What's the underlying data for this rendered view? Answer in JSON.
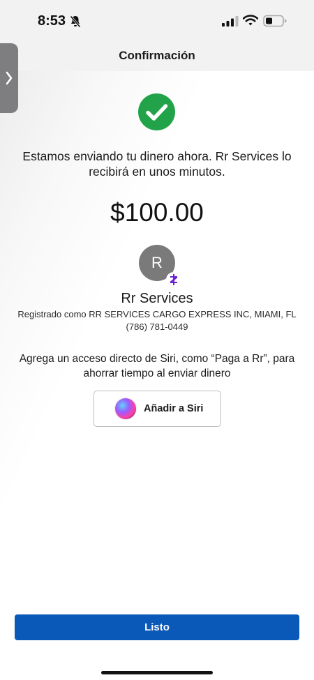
{
  "status_bar": {
    "time": "8:53"
  },
  "header": {
    "title": "Confirmación"
  },
  "confirmation": {
    "message": "Estamos enviando tu dinero ahora. Rr Services lo recibirá en unos minutos.",
    "amount": "$100.00"
  },
  "recipient": {
    "initial": "R",
    "name": "Rr Services",
    "registered": "Registrado como RR SERVICES CARGO EXPRESS INC, MIAMI, FL",
    "phone": "(786) 781-0449"
  },
  "siri": {
    "description": "Agrega un acceso directo de Siri, como “Paga a Rr”, para ahorrar tiempo al enviar dinero",
    "button_label": "Añadir a Siri"
  },
  "footer": {
    "done_label": "Listo"
  },
  "colors": {
    "primary": "#0a58b8",
    "success": "#22a34a",
    "zelle": "#6d1ed4",
    "avatar": "#7a7a7a"
  },
  "icons": {
    "status": [
      "bell-off-icon",
      "signal-icon",
      "wifi-icon",
      "battery-icon"
    ],
    "success": "checkmark-circle-icon",
    "side": "chevron-right-icon",
    "badge": "zelle-icon",
    "siri": "siri-icon"
  }
}
